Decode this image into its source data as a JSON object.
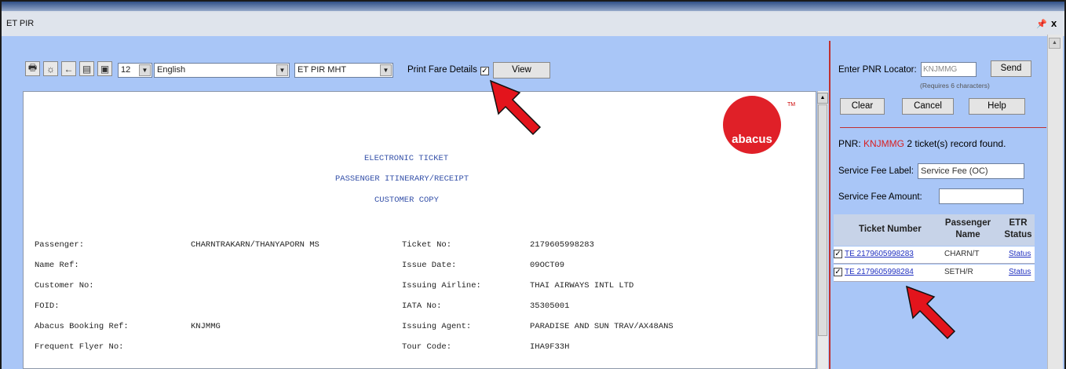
{
  "window": {
    "title": "ET PIR",
    "pin_icon": "pin-icon",
    "close_glyph": "x"
  },
  "toolbar": {
    "font_size": "12",
    "language": "English",
    "template": "ET PIR MHT",
    "print_fare_label": "Print Fare Details",
    "print_fare_checked": true,
    "view_label": "View"
  },
  "document": {
    "logo": "abacus",
    "logo_tm": "TM",
    "heading": [
      "ELECTRONIC TICKET",
      "PASSENGER ITINERARY/RECEIPT",
      "CUSTOMER COPY"
    ],
    "left_fields": [
      {
        "label": "Passenger:",
        "value": "CHARNTRAKARN/THANYAPORN MS"
      },
      {
        "label": "Name Ref:",
        "value": ""
      },
      {
        "label": "Customer No:",
        "value": ""
      },
      {
        "label": "FOID:",
        "value": ""
      },
      {
        "label": "Abacus Booking Ref:",
        "value": "KNJMMG"
      },
      {
        "label": "Frequent Flyer No:",
        "value": ""
      }
    ],
    "right_fields": [
      {
        "label": "Ticket No:",
        "value": "2179605998283"
      },
      {
        "label": "Issue Date:",
        "value": "09OCT09"
      },
      {
        "label": "Issuing Airline:",
        "value": "THAI AIRWAYS INTL LTD"
      },
      {
        "label": "IATA No:",
        "value": "35305001"
      },
      {
        "label": "Issuing Agent:",
        "value": "PARADISE AND SUN TRAV/AX48ANS"
      },
      {
        "label": "Tour Code:",
        "value": "IHA9F33H"
      }
    ]
  },
  "panel": {
    "pnr_label": "Enter PNR Locator:",
    "pnr_value": "KNJMMG",
    "send_label": "Send",
    "requirement_note": "(Requires 6 characters)",
    "clear_label": "Clear",
    "cancel_label": "Cancel",
    "help_label": "Help",
    "pnr_prefix": "PNR:",
    "pnr_code": "KNJMMG",
    "pnr_result": "2 ticket(s) record found.",
    "fee_label_caption": "Service Fee Label:",
    "fee_label_value": "Service Fee (OC)",
    "fee_amount_caption": "Service Fee Amount:",
    "fee_amount_value": ""
  },
  "tickets": {
    "headers": [
      "Ticket Number",
      "Passenger Name",
      "ETR Status"
    ],
    "rows": [
      {
        "checked": true,
        "ticket": "TE 2179605998283",
        "passenger": "CHARN/T",
        "status": "Status"
      },
      {
        "checked": true,
        "ticket": "TE 2179605998284",
        "passenger": "SETH/R",
        "status": "Status"
      }
    ]
  },
  "colors": {
    "panel_bg": "#a9c6f7",
    "accent_red": "#e02028",
    "divider": "#c03030"
  }
}
